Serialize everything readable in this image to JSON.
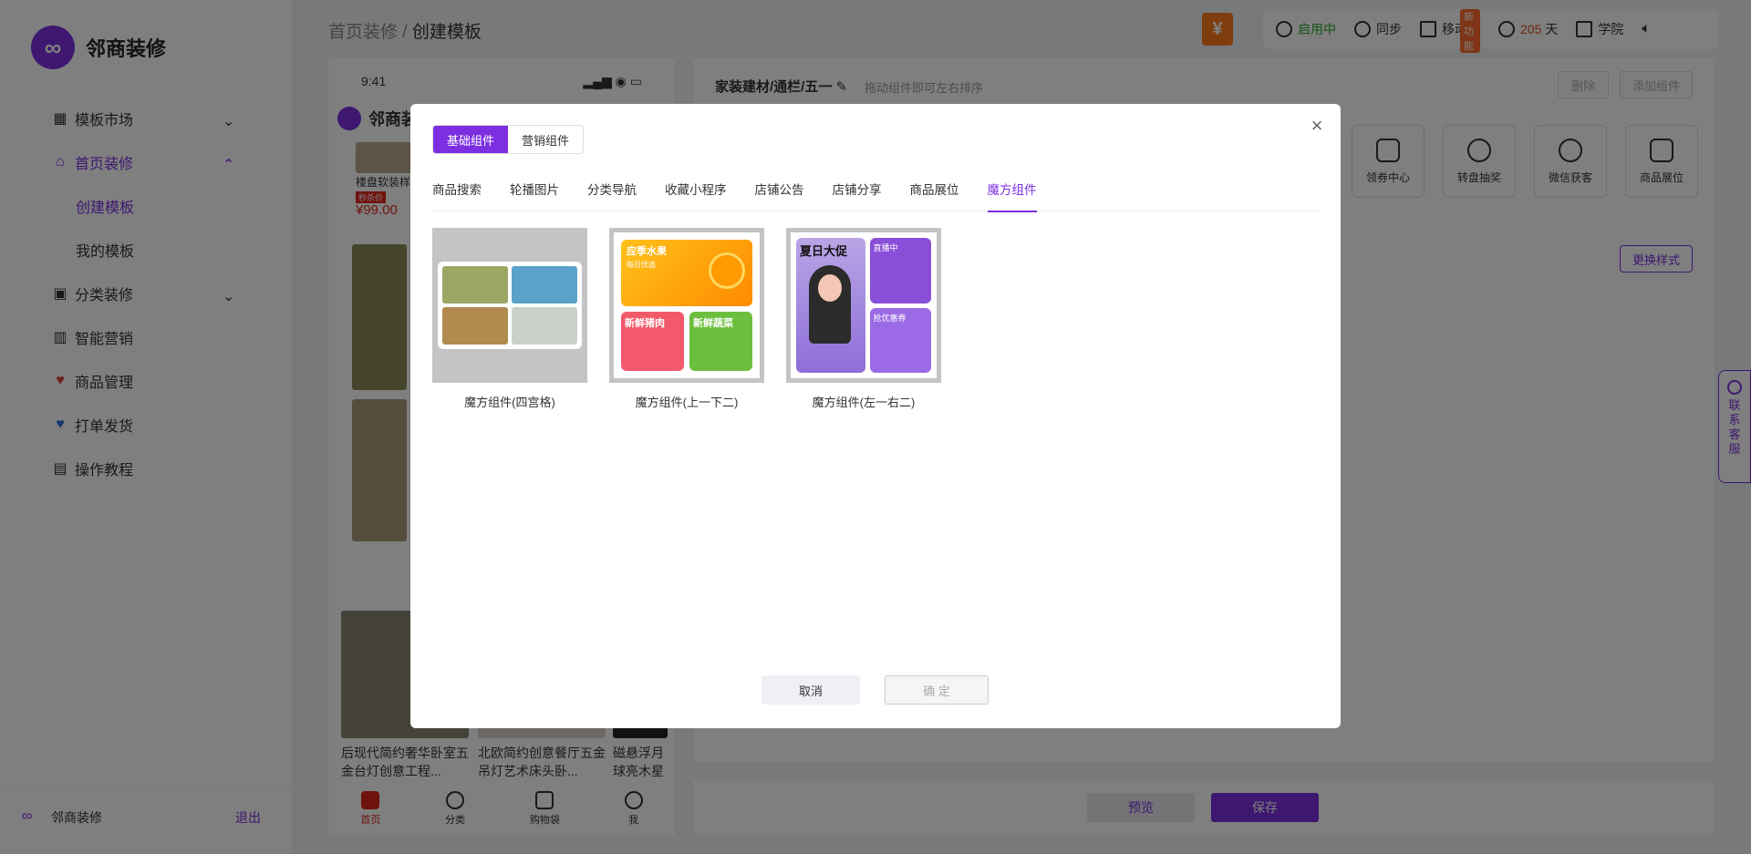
{
  "sidebar": {
    "brand": "邻商装修",
    "brand_mark": "∞",
    "items": [
      {
        "label": "模板市场",
        "icon": "template-icon"
      },
      {
        "label": "首页装修",
        "icon": "home-icon"
      },
      {
        "label": "分类装修",
        "icon": "category-icon"
      },
      {
        "label": "智能营销",
        "icon": "chart-icon"
      },
      {
        "label": "商品管理",
        "icon": "product-icon"
      },
      {
        "label": "打单发货",
        "icon": "shipping-icon"
      },
      {
        "label": "操作教程",
        "icon": "tutorial-icon"
      }
    ],
    "subitems": [
      "创建模板",
      "我的模板"
    ],
    "footer_name": "邻商装修",
    "logout": "退出"
  },
  "breadcrumb": {
    "parent": "首页装修",
    "sep": "/",
    "current": "创建模板"
  },
  "toolbar": {
    "coin": "¥",
    "status": "启用中",
    "sync": "同步",
    "mobile": "移动端",
    "new_tag": "新功能",
    "days_value": "205",
    "days_unit": "天",
    "academy": "学院"
  },
  "phone": {
    "time": "9:41",
    "app_name": "邻商装修",
    "product1_title": "楼盘软装样",
    "product1_tag": "秒杀价",
    "product1_price": "¥99.00",
    "product2_title": "后现代简约奢华卧室五金台灯创意工程...",
    "product3_title": "北欧简约创意餐厅五金吊灯艺术床头卧...",
    "product4_title": "磁悬浮月球亮木星创",
    "tabs": [
      "首页",
      "分类",
      "购物袋",
      "我"
    ]
  },
  "editor": {
    "title": "家装建材/通栏/五一",
    "hint": "拖动组件即可左右排序",
    "delete": "删除",
    "add": "添加组件",
    "components": [
      "领券中心",
      "转盘抽奖",
      "微信获客",
      "商品展位"
    ],
    "change_style": "更换样式",
    "preview": "预览",
    "save": "保存"
  },
  "contact": [
    "联",
    "系",
    "客",
    "服"
  ],
  "modal": {
    "seg": [
      "基础组件",
      "营销组件"
    ],
    "tabs": [
      "商品搜索",
      "轮播图片",
      "分类导航",
      "收藏小程序",
      "店铺公告",
      "店铺分享",
      "商品展位",
      "魔方组件"
    ],
    "cards": [
      {
        "caption": "魔方组件(四宫格)"
      },
      {
        "caption": "魔方组件(上一下二)",
        "top_title": "应季水果",
        "top_sub": "每日优选",
        "b1": "新鲜猪肉",
        "b2": "新鲜蔬菜"
      },
      {
        "caption": "魔方组件(左一右二)",
        "left_title": "夏日大促",
        "r1": "直播中",
        "r2": "抢优惠券"
      }
    ],
    "cancel": "取消",
    "ok": "确 定",
    "close": "×"
  }
}
